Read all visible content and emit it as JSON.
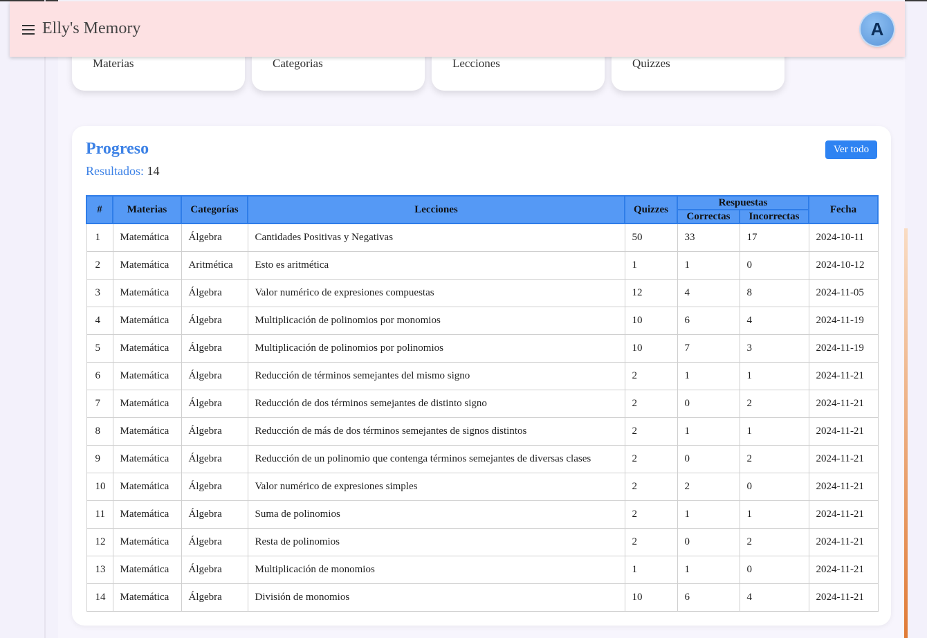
{
  "header": {
    "title": "Elly's Memory",
    "avatar_letter": "A"
  },
  "stat_cards": [
    {
      "label": "Materias"
    },
    {
      "label": "Categorias"
    },
    {
      "label": "Lecciones"
    },
    {
      "label": "Quizzes"
    }
  ],
  "progress": {
    "title": "Progreso",
    "results_label": "Resultados:",
    "results_count": "14",
    "see_all_label": "Ver todo"
  },
  "table": {
    "headers": {
      "num": "#",
      "subjects": "Materias",
      "categories": "Categorías",
      "lessons": "Lecciones",
      "quizzes": "Quizzes",
      "answers": "Respuestas",
      "correct": "Correctas",
      "incorrect": "Incorrectas",
      "date": "Fecha"
    },
    "rows": [
      [
        "1",
        "Matemática",
        "Álgebra",
        "Cantidades Positivas y Negativas",
        "50",
        "33",
        "17",
        "2024-10-11"
      ],
      [
        "2",
        "Matemática",
        "Aritmética",
        "Esto es aritmética",
        "1",
        "1",
        "0",
        "2024-10-12"
      ],
      [
        "3",
        "Matemática",
        "Álgebra",
        "Valor numérico de expresiones compuestas",
        "12",
        "4",
        "8",
        "2024-11-05"
      ],
      [
        "4",
        "Matemática",
        "Álgebra",
        "Multiplicación de polinomios por monomios",
        "10",
        "6",
        "4",
        "2024-11-19"
      ],
      [
        "5",
        "Matemática",
        "Álgebra",
        "Multiplicación de polinomios por polinomios",
        "10",
        "7",
        "3",
        "2024-11-19"
      ],
      [
        "6",
        "Matemática",
        "Álgebra",
        "Reducción de términos semejantes del mismo signo",
        "2",
        "1",
        "1",
        "2024-11-21"
      ],
      [
        "7",
        "Matemática",
        "Álgebra",
        "Reducción de dos términos semejantes de distinto signo",
        "2",
        "0",
        "2",
        "2024-11-21"
      ],
      [
        "8",
        "Matemática",
        "Álgebra",
        "Reducción de más de dos términos semejantes de signos distintos",
        "2",
        "1",
        "1",
        "2024-11-21"
      ],
      [
        "9",
        "Matemática",
        "Álgebra",
        "Reducción de un polinomio que contenga términos semejantes de diversas clases",
        "2",
        "0",
        "2",
        "2024-11-21"
      ],
      [
        "10",
        "Matemática",
        "Álgebra",
        "Valor numérico de expresiones simples",
        "2",
        "2",
        "0",
        "2024-11-21"
      ],
      [
        "11",
        "Matemática",
        "Álgebra",
        "Suma de polinomios",
        "2",
        "1",
        "1",
        "2024-11-21"
      ],
      [
        "12",
        "Matemática",
        "Álgebra",
        "Resta de polinomios",
        "2",
        "0",
        "2",
        "2024-11-21"
      ],
      [
        "13",
        "Matemática",
        "Álgebra",
        "Multiplicación de monomios",
        "1",
        "1",
        "0",
        "2024-11-21"
      ],
      [
        "14",
        "Matemática",
        "Álgebra",
        "División de monomios",
        "10",
        "6",
        "4",
        "2024-11-21"
      ]
    ]
  },
  "colors": {
    "header_bg": "#fde1e3",
    "accent": "#3d82e6",
    "table_header_bg": "#5599f5",
    "button_bg": "#2e83f2"
  },
  "icons": {
    "menu": "menu-icon",
    "avatar": "user-avatar"
  }
}
